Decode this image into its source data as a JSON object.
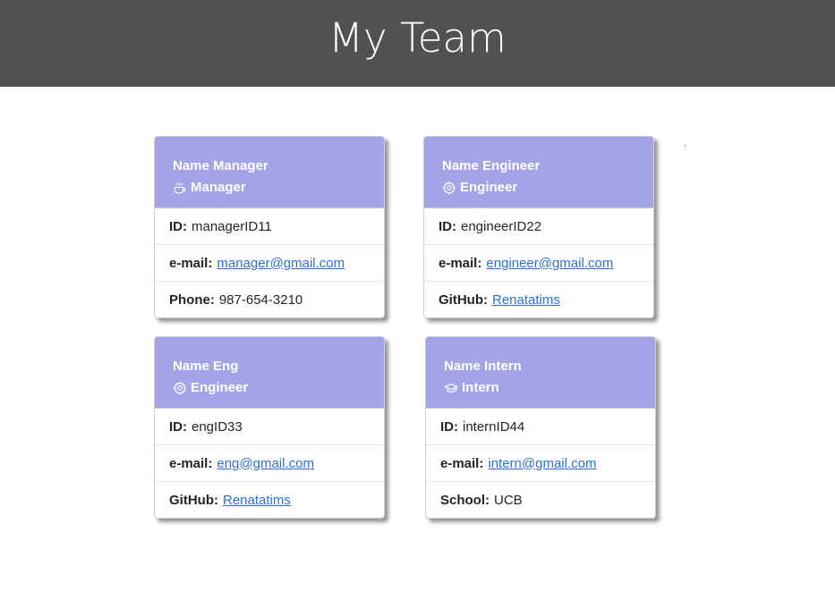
{
  "header": {
    "title": "My Team"
  },
  "stray_mark": ",",
  "cards": [
    {
      "name": "Name Manager",
      "role": "Manager",
      "role_icon": "coffee-cup-icon",
      "rows": [
        {
          "label": "ID:",
          "value": "managerID11"
        },
        {
          "label": "e-mail:",
          "value": "manager@gmail.com"
        },
        {
          "label": "Phone:",
          "value": "987-654-3210"
        }
      ]
    },
    {
      "name": "Name Engineer",
      "role": "Engineer",
      "role_icon": "gear-icon",
      "rows": [
        {
          "label": "ID:",
          "value": "engineerID22"
        },
        {
          "label": "e-mail:",
          "value": "engineer@gmail.com"
        },
        {
          "label": "GitHub:",
          "value": "Renatatims"
        }
      ]
    },
    {
      "name": "Name Eng",
      "role": "Engineer",
      "role_icon": "gear-icon",
      "rows": [
        {
          "label": "ID:",
          "value": "engID33"
        },
        {
          "label": "e-mail:",
          "value": "eng@gmail.com"
        },
        {
          "label": "GitHub:",
          "value": "Renatatims"
        }
      ]
    },
    {
      "name": "Name Intern",
      "role": "Intern",
      "role_icon": "graduation-cap-icon",
      "rows": [
        {
          "label": "ID:",
          "value": "internID44"
        },
        {
          "label": "e-mail:",
          "value": "intern@gmail.com"
        },
        {
          "label": "School:",
          "value": "UCB"
        }
      ]
    }
  ],
  "colors": {
    "header_bg": "#525050",
    "card_head_bg": "#a3a3e7",
    "link": "#2e6fd6"
  }
}
